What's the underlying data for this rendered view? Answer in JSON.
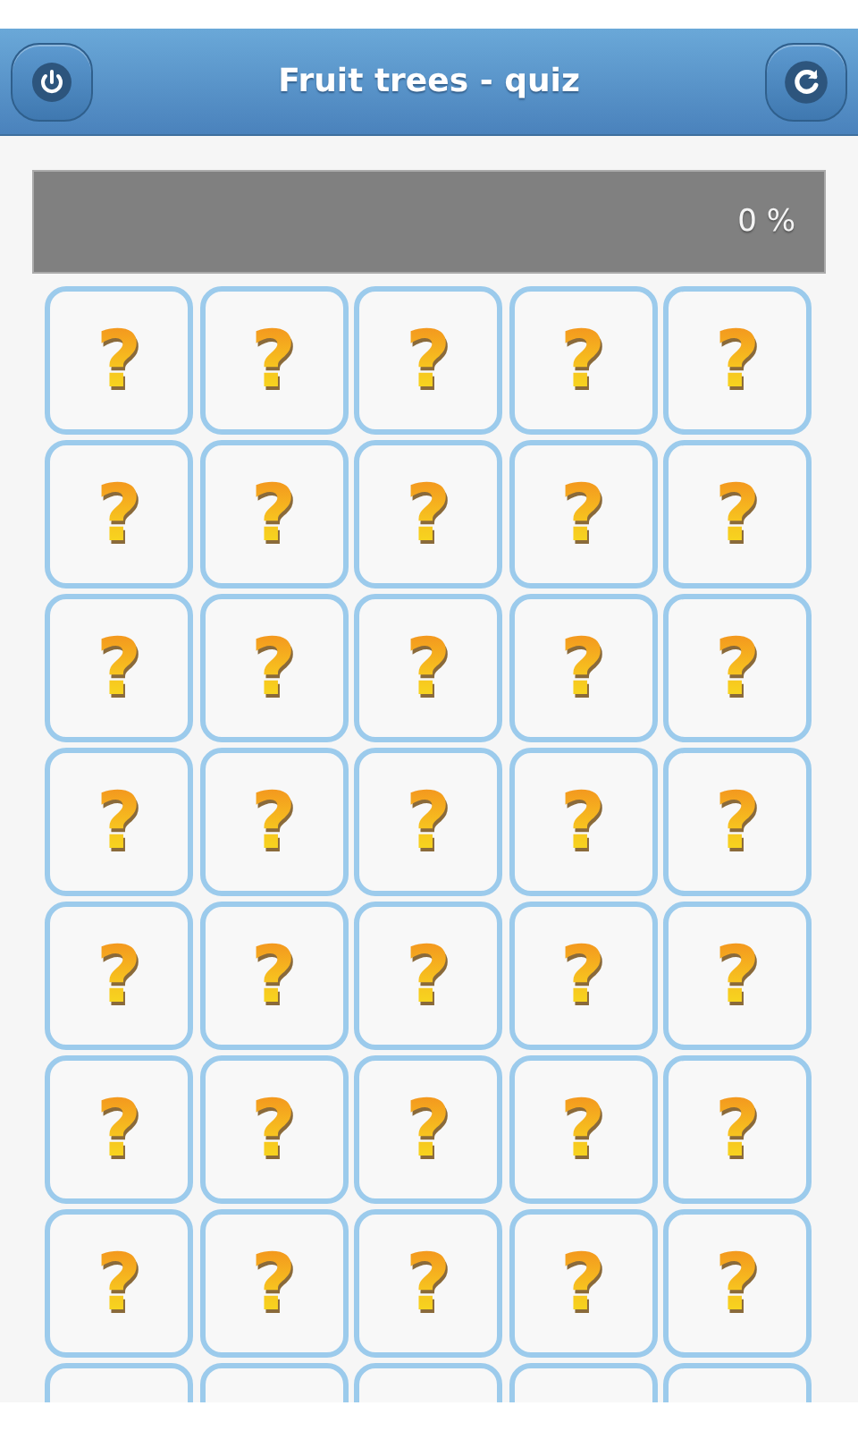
{
  "header": {
    "title": "Fruit trees - quiz"
  },
  "progress": {
    "level": 0,
    "reading": "0 %"
  },
  "cards": [
    {
      "kind": "question",
      "label": "?"
    },
    {
      "kind": "question",
      "label": "?"
    },
    {
      "kind": "question",
      "label": "?"
    },
    {
      "kind": "question",
      "label": "?"
    },
    {
      "kind": "question",
      "label": "?"
    },
    {
      "kind": "question",
      "label": "?"
    },
    {
      "kind": "question",
      "label": "?"
    },
    {
      "kind": "question",
      "label": "?"
    },
    {
      "kind": "question",
      "label": "?"
    },
    {
      "kind": "question",
      "label": "?"
    },
    {
      "kind": "question",
      "label": "?"
    },
    {
      "kind": "question",
      "label": "?"
    },
    {
      "kind": "question",
      "label": "?"
    },
    {
      "kind": "question",
      "label": "?"
    },
    {
      "kind": "question",
      "label": "?"
    },
    {
      "kind": "question",
      "label": "?"
    },
    {
      "kind": "question",
      "label": "?"
    },
    {
      "kind": "question",
      "label": "?"
    },
    {
      "kind": "question",
      "label": "?"
    },
    {
      "kind": "question",
      "label": "?"
    },
    {
      "kind": "question",
      "label": "?"
    },
    {
      "kind": "question",
      "label": "?"
    },
    {
      "kind": "question",
      "label": "?"
    },
    {
      "kind": "question",
      "label": "?"
    },
    {
      "kind": "question",
      "label": "?"
    },
    {
      "kind": "question",
      "label": "?"
    },
    {
      "kind": "question",
      "label": "?"
    },
    {
      "kind": "question",
      "label": "?"
    },
    {
      "kind": "question",
      "label": "?"
    },
    {
      "kind": "question",
      "label": "?"
    },
    {
      "kind": "question",
      "label": "?"
    },
    {
      "kind": "question",
      "label": "?"
    },
    {
      "kind": "question",
      "label": "?"
    },
    {
      "kind": "question",
      "label": "?"
    },
    {
      "kind": "question",
      "label": "?"
    },
    {
      "kind": "blank"
    },
    {
      "kind": "blank"
    },
    {
      "kind": "blank"
    },
    {
      "kind": "blank"
    },
    {
      "kind": "blank"
    }
  ]
}
